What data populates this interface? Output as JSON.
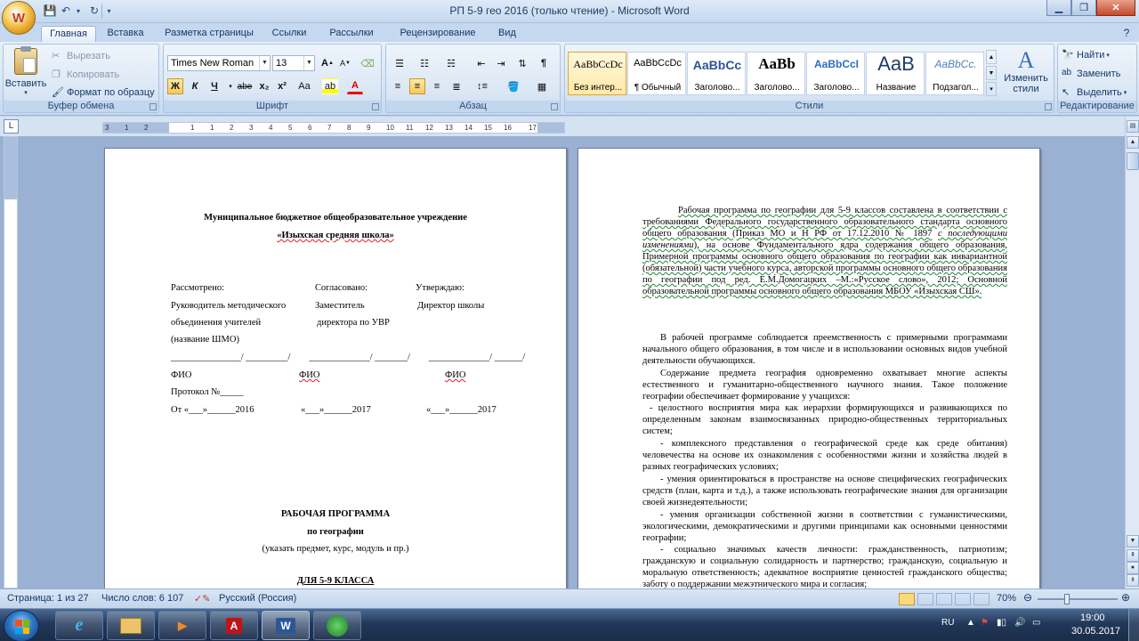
{
  "window": {
    "title": "РП 5-9 гео 2016 (только чтение) - Microsoft Word",
    "office_button": "W"
  },
  "tabs": [
    "Главная",
    "Вставка",
    "Разметка страницы",
    "Ссылки",
    "Рассылки",
    "Рецензирование",
    "Вид"
  ],
  "clipboard": {
    "paste": "Вставить",
    "cut": "Вырезать",
    "copy": "Копировать",
    "format_painter": "Формат по образцу",
    "label": "Буфер обмена"
  },
  "font": {
    "name": "Times New Roman",
    "size": "13",
    "bold": "Ж",
    "italic": "К",
    "underline": "Ч",
    "strike": "abe",
    "subscript": "x₂",
    "superscript": "x²",
    "change_case": "Aa",
    "label": "Шрифт"
  },
  "paragraph": {
    "label": "Абзац"
  },
  "styles": {
    "label": "Стили",
    "tiles": [
      {
        "sample": "AaBbCcDc",
        "name": "Без интер..."
      },
      {
        "sample": "AaBbCcDc",
        "name": "¶ Обычный"
      },
      {
        "sample": "AaBbCc",
        "name": "Заголово..."
      },
      {
        "sample": "AaBb",
        "name": "Заголово..."
      },
      {
        "sample": "AaBbCcI",
        "name": "Заголово..."
      },
      {
        "sample": "AaB",
        "name": "Название"
      },
      {
        "sample": "AaBbCc.",
        "name": "Подзагол..."
      }
    ],
    "change_styles": "Изменить стили"
  },
  "editing": {
    "label": "Редактирование",
    "find": "Найти",
    "replace": "Заменить",
    "select": "Выделить"
  },
  "ruler_ticks": [
    "3",
    "1",
    "2",
    "1",
    "1",
    "2",
    "3",
    "4",
    "5",
    "6",
    "7",
    "8",
    "9",
    "10",
    "11",
    "12",
    "13",
    "14",
    "15",
    "16",
    "17"
  ],
  "page1": {
    "org_line1": "Муниципальное бюджетное общеобразовательное учреждение",
    "org_line2": "«Изыхская  средняя  школа»",
    "col1": [
      "Рассмотрено:",
      "Руководитель методического",
      "объединения  учителей",
      "(название ШМО)"
    ],
    "col2": [
      "Согласовано:",
      "Заместитель",
      "директора по УВР"
    ],
    "col3": [
      "Утверждаю:",
      "Директор школы"
    ],
    "sig_line": "_______________/ _________/        _____________/ _______/        _____________/ ______/",
    "fio": [
      "ФИО",
      "ФИО",
      "ФИО"
    ],
    "protocol": "Протокол №_____",
    "dates": [
      "От «___»______2016",
      "«___»______2017",
      "«___»______2017"
    ],
    "program_title": "РАБОЧАЯ  ПРОГРАММА",
    "subject": "по географии",
    "subject_note": "(указать предмет, курс, модуль и пр.)",
    "grade": "ДЛЯ  5-9   КЛАССА"
  },
  "page2": {
    "p1_a": "Рабочая программа по географии для 5-9 классов составлена в соответствии с требованиями Федерального государственного образовательного стандарта основного общего образования (Приказ МО и Н РФ от 17.12.2010 № 1897",
    "p1_italic": "с последующими изменениями",
    "p1_b": "), на основе Фундаментального ядра содержания общего образования, Примерной программы основного общего образования по географии как инвариантной (обязательной) части учебного курса, авторской программы основного общего образования по географии под ред. Е.М.Домогацких –М.:«Русское слово», 2012; Основной образовательной программы основного общего образования  МБОУ «Изыхская СШ».",
    "p2": "В рабочей программе соблюдается преемственность с примерными программами начального общего образования, в том числе и в использовании основных видов учебной деятельности обучающихся.",
    "p3": "Содержание предмета география одновременно охватывает многие аспекты естественного и гуманитарно-общественного научного знания. Такое положение географии обеспечивает формирование у учащихся:",
    "list": [
      "- целостного восприятия мира как иерархии формирующихся и развивающихся по определенным  законам взаимосвязанных природно-общественных территориальных  систем;",
      "- комплексного представления о географической среде как среде обитания) человечества на основе их ознакомления с особенностями жизни и хозяйства людей в разных географических условиях;",
      "- умения ориентироваться в пространстве на основе специфических географических средств (план, карта и т.д.), а также использовать географические знания для организации  своей жизнедеятельности;",
      "- умения организации собственной жизни в соответствии с гуманистическими, экологическими, демократическими и другими принципами как основными ценностями географии;",
      "- социально значимых качеств личности: гражданственность, патриотизм; гражданскую и социальную солидарность и партнерство; гражданскую, социальную и моральную ответственность; адекватное восприятие ценностей гражданского общества; заботу о поддержании межэтнического мира и согласия;"
    ]
  },
  "status": {
    "page": "Страница: 1 из 27",
    "words": "Число слов: 6 107",
    "language": "Русский (Россия)",
    "zoom": "70%"
  },
  "taskbar": {
    "lang": "RU",
    "time": "19:00",
    "date": "30.05.2017"
  }
}
